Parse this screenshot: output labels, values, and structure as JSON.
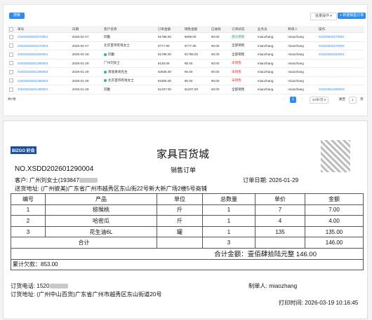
{
  "list_panel": {
    "search_label": "搜索",
    "batch_label": "批量操作",
    "new_label": "+ 新建销售订单",
    "columns": [
      "单号",
      "日期",
      "客户名称",
      "订单金额",
      "销售金额",
      "已收款",
      "订单状态",
      "业务员",
      "制单人",
      "操作"
    ],
    "rows": [
      {
        "no": "XSDD202602270001",
        "date": "2026-02-27",
        "customer": "同勤",
        "amount": "¥1798.00",
        "sales": "¥899.00",
        "received": "¥0.00",
        "status": "部分销售",
        "status_color": "green",
        "salesman": "miaozhang",
        "maker": "miaozhang",
        "op": "XS202602270001",
        "dot": false
      },
      {
        "no": "XSDD202602270002",
        "date": "2026-02-27",
        "customer": "北京首饰有限女士",
        "amount": "¥777.90",
        "sales": "¥777.90",
        "received": "¥0.00",
        "status": "全部销售",
        "status_color": "",
        "salesman": "miaozhang",
        "maker": "miaozhang",
        "op": "XS202602270002",
        "dot": false
      },
      {
        "no": "XSDD202602260001",
        "date": "2026-02-26",
        "customer": "同勤",
        "amount": "¥1798.00",
        "sales": "¥1798.00",
        "received": "¥0.00",
        "status": "全部销售",
        "status_color": "",
        "salesman": "miaozhang",
        "maker": "miaozhang",
        "op": "XS202602260001",
        "dot": true
      },
      {
        "no": "XSDD202601290004",
        "date": "2026-01-29",
        "customer": "广州刘女士",
        "amount": "¥146.00",
        "sales": "¥0.00",
        "received": "¥0.00",
        "status": "未销售",
        "status_color": "red",
        "salesman": "miaozhang",
        "maker": "miaozhang",
        "op": "",
        "dot": false
      },
      {
        "no": "XSDD202601290003",
        "date": "2026-01-29",
        "customer": "南丽果商先生",
        "amount": "¥2835.00",
        "sales": "¥0.00",
        "received": "¥0.00",
        "status": "未销售",
        "status_color": "red",
        "salesman": "miaozhang",
        "maker": "miaozhang",
        "op": "",
        "dot": true
      },
      {
        "no": "XSDD202601290002",
        "date": "2026-01-29",
        "customer": "北京首饰有限女士",
        "amount": "¥1805.00",
        "sales": "¥0.00",
        "received": "¥0.00",
        "status": "未销售",
        "status_color": "red",
        "salesman": "miaozhang",
        "maker": "miaozhang",
        "op": "",
        "dot": true
      },
      {
        "no": "XSDD202601290001",
        "date": "2026-01-29",
        "customer": "同勤",
        "amount": "¥1207.00",
        "sales": "¥1207.00",
        "received": "¥0.00",
        "status": "全部销售",
        "status_color": "",
        "salesman": "miaozhang",
        "maker": "miaozhang",
        "op": "XS202601290003",
        "dot": false
      }
    ],
    "total_label": "共7条",
    "current_page": "1",
    "page_size": "20条/页",
    "goto_label": "跳至",
    "goto_value": "1",
    "page_unit": "页"
  },
  "receipt": {
    "logo": "BIZGO 好会",
    "title": "家具百货城",
    "subtitle": "销售订单",
    "order_no": "NO.XSDD202601290004",
    "customer_prefix": "客户: 广州刘女士(193847",
    "order_date": "订单日期: 2026-01-29",
    "address": "送货地址: (广州彼美)广东省广州市越秀区东山街22号新大新广场2楼5号商铺",
    "headers": [
      "编号",
      "产品",
      "单位",
      "总数量",
      "单价",
      "金额"
    ],
    "items": [
      {
        "no": "1",
        "product": "猕猴桃",
        "unit": "斤",
        "qty": "1",
        "price": "7",
        "amount": "7.00"
      },
      {
        "no": "2",
        "product": "哈密瓜",
        "unit": "斤",
        "qty": "1",
        "price": "4",
        "amount": "4.00"
      },
      {
        "no": "3",
        "product": "花生油6L",
        "unit": "罐",
        "qty": "1",
        "price": "135",
        "amount": "135.00"
      }
    ],
    "subtotal_label": "合计",
    "subtotal_qty": "3",
    "subtotal_amount": "146.00",
    "total_text": "合计金额：壹佰肆拾陆元整 146.00",
    "debt": "累计欠款：853.00",
    "phone_prefix": "订货电话: 1520",
    "maker": "制单人: miaozhang",
    "order_address": "订货地址: (广州中山百货)广东省广州市越秀区东山街道20号",
    "print_time": "打印时间: 2026-03-19 10:16:45"
  }
}
